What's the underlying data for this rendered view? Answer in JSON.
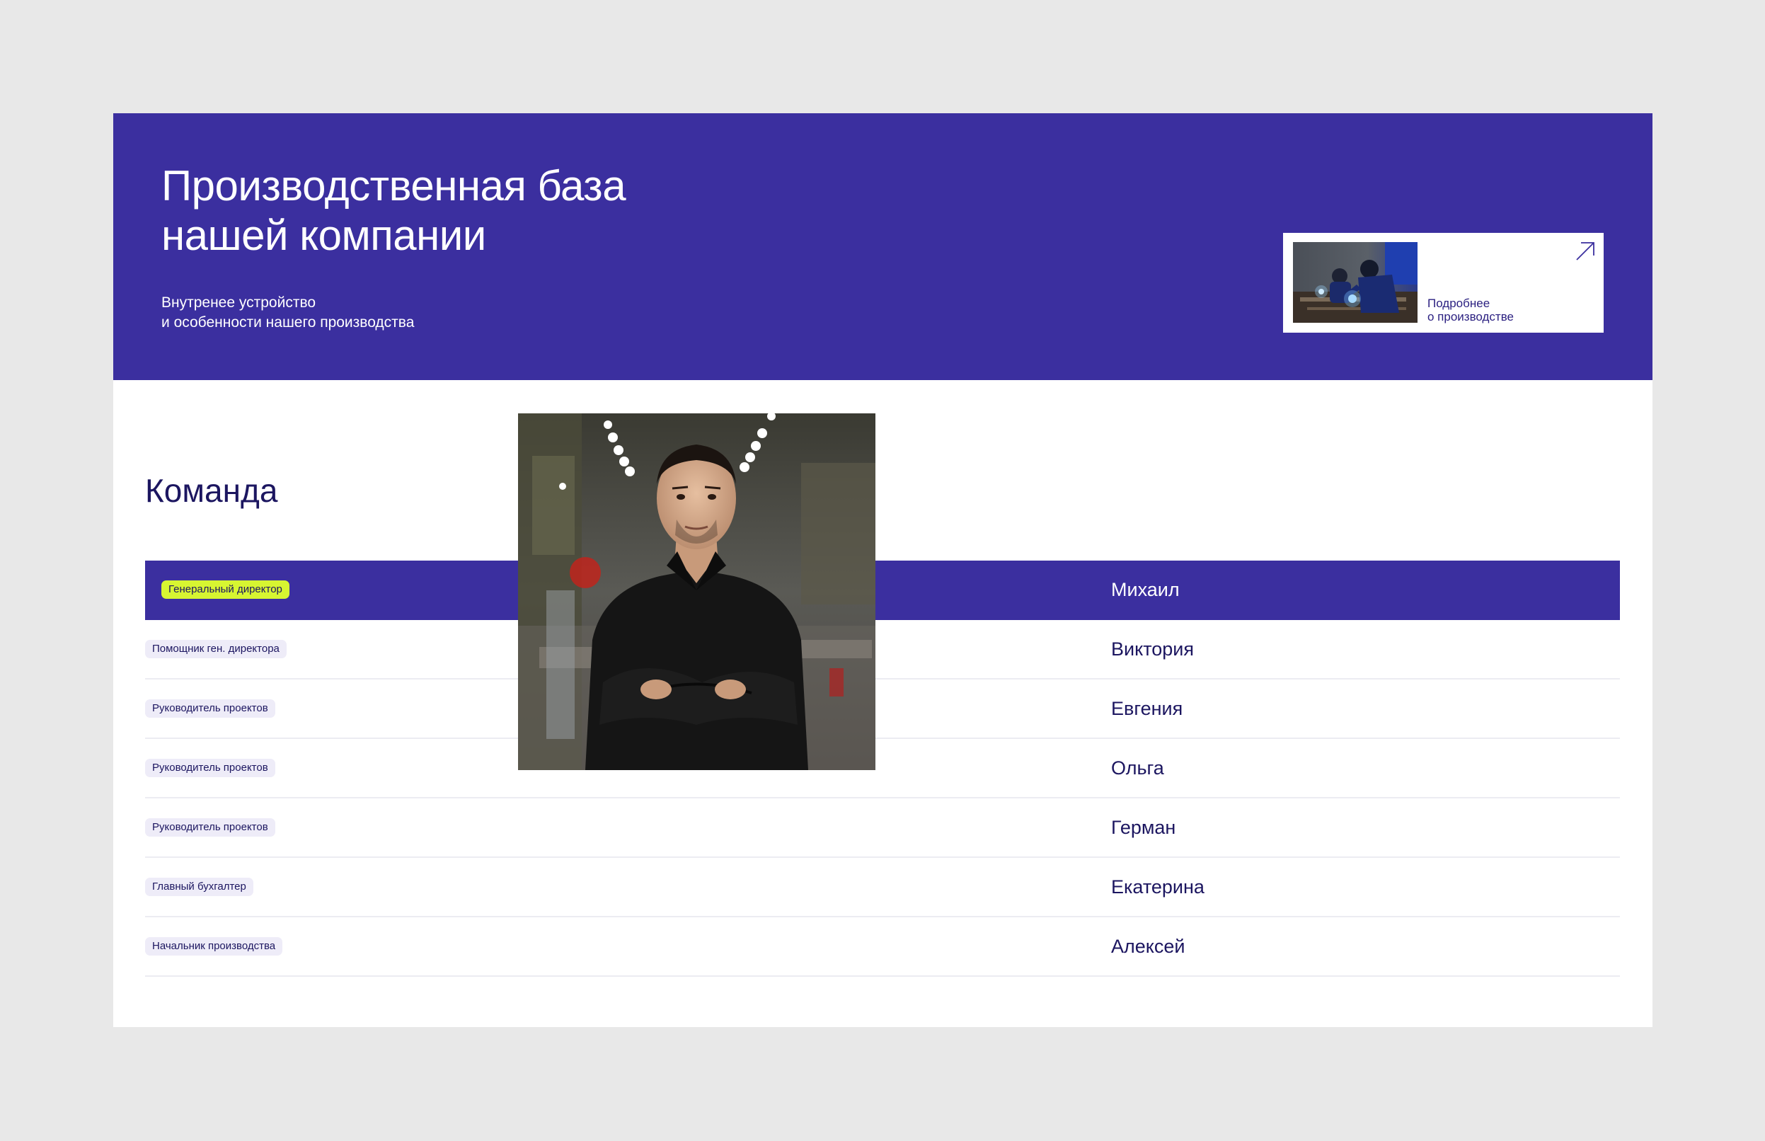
{
  "hero": {
    "title_line1": "Производственная база",
    "title_line2": "нашей компании",
    "subtitle_line1": "Внутренее устройство",
    "subtitle_line2": "и особенности нашего производства",
    "promo_line1": "Подробнее",
    "promo_line2": "о производстве"
  },
  "team": {
    "title": "Команда",
    "members": [
      {
        "role": "Генеральный директор",
        "name": "Михаил"
      },
      {
        "role": "Помощник ген. директора",
        "name": "Виктория"
      },
      {
        "role": "Руководитель проектов",
        "name": "Евгения"
      },
      {
        "role": "Руководитель проектов",
        "name": "Ольга"
      },
      {
        "role": "Руководитель проектов",
        "name": "Герман"
      },
      {
        "role": "Главный бухгалтер",
        "name": "Екатерина"
      },
      {
        "role": "Начальник производства",
        "name": "Алексей"
      }
    ]
  },
  "colors": {
    "brand_purple": "#3b2f9f",
    "accent_lime": "#d7f531",
    "text_dark": "#1c1660",
    "page_bg": "#e8e8e8"
  },
  "icons": {
    "promo_arrow": "arrow-up-right-icon"
  }
}
